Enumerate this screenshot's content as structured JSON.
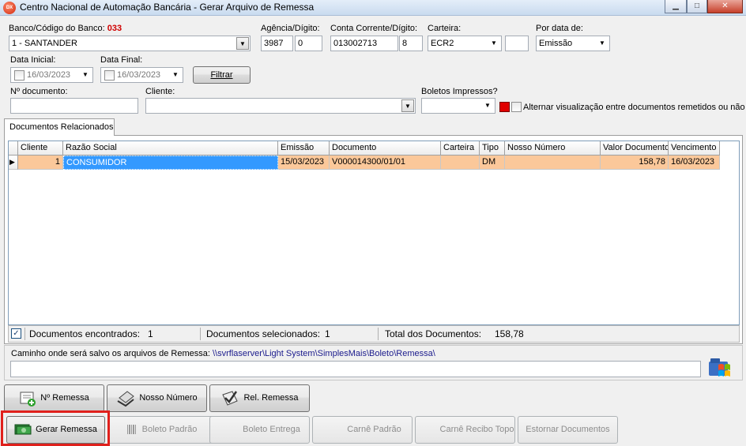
{
  "window": {
    "app_icon": "DX",
    "title": "Centro Nacional de Automação Bancária - Gerar Arquivo de Remessa",
    "minimize": "▁",
    "maximize": "□",
    "close": "✕"
  },
  "filters": {
    "banco_label": "Banco/Código do Banco:",
    "banco_codigo": "033",
    "banco_value": "1 - SANTANDER",
    "agencia_label": "Agência/Dígito:",
    "agencia_value": "3987",
    "agencia_digito": "0",
    "conta_label": "Conta Corrente/Dígito:",
    "conta_value": "013002713",
    "conta_digito": "8",
    "carteira_label": "Carteira:",
    "carteira_value": "ECR2",
    "carteira_extra": "",
    "por_data_label": "Por data de:",
    "por_data_value": "Emissão",
    "data_inicial_label": "Data Inicial:",
    "data_inicial_value": "16/03/2023",
    "data_final_label": "Data Final:",
    "data_final_value": "16/03/2023",
    "filtrar_label": "Filtrar",
    "documento_label": "Nº documento:",
    "documento_value": "",
    "cliente_label": "Cliente:",
    "cliente_value": "",
    "boletos_label": "Boletos Impressos?",
    "boletos_value": "",
    "alternar_label": "Alternar visualização entre documentos remetidos ou não",
    "remetidos_color": "#e00000"
  },
  "tab": {
    "label": "Documentos Relacionados"
  },
  "grid": {
    "columns": [
      "Cliente",
      "Razão Social",
      "Emissão",
      "Documento",
      "Carteira",
      "Tipo",
      "Nosso Número",
      "Valor Documento",
      "Vencimento"
    ],
    "rows": [
      {
        "indicator": "▶",
        "cliente": "1",
        "razao_social": "CONSUMIDOR",
        "emissao": "15/03/2023",
        "documento": "V000014300/01/01",
        "carteira": "",
        "tipo": "DM",
        "nosso_numero": "",
        "valor": "158,78",
        "vencimento": "16/03/2023"
      }
    ]
  },
  "status": {
    "check": "✓",
    "encontrados_label": "Documentos encontrados:",
    "encontrados_value": "1",
    "selecionados_label": "Documentos selecionados:",
    "selecionados_value": "1",
    "total_label": "Total dos Documentos:",
    "total_value": "158,78"
  },
  "path": {
    "label": "Caminho onde será salvo os arquivos de Remessa:",
    "value": "\\\\svrflaserver\\Light System\\SimplesMais\\Boleto\\Remessa\\",
    "input_value": ""
  },
  "buttons": {
    "nro_remessa": "Nº Remessa",
    "nosso_numero": "Nosso Número",
    "rel_remessa": "Rel. Remessa",
    "gerar_remessa": "Gerar Remessa",
    "boleto_padrao": "Boleto Padrão",
    "boleto_entrega": "Boleto Entrega",
    "carne_padrao": "Carnê Padrão",
    "carne_recibo_topo": "Carnê Recibo Topo",
    "estornar_documentos": "Estornar Documentos"
  },
  "colors": {
    "row_highlight": "#fbc89a",
    "selection": "#3399ff",
    "highlight_box": "#e0201c"
  }
}
